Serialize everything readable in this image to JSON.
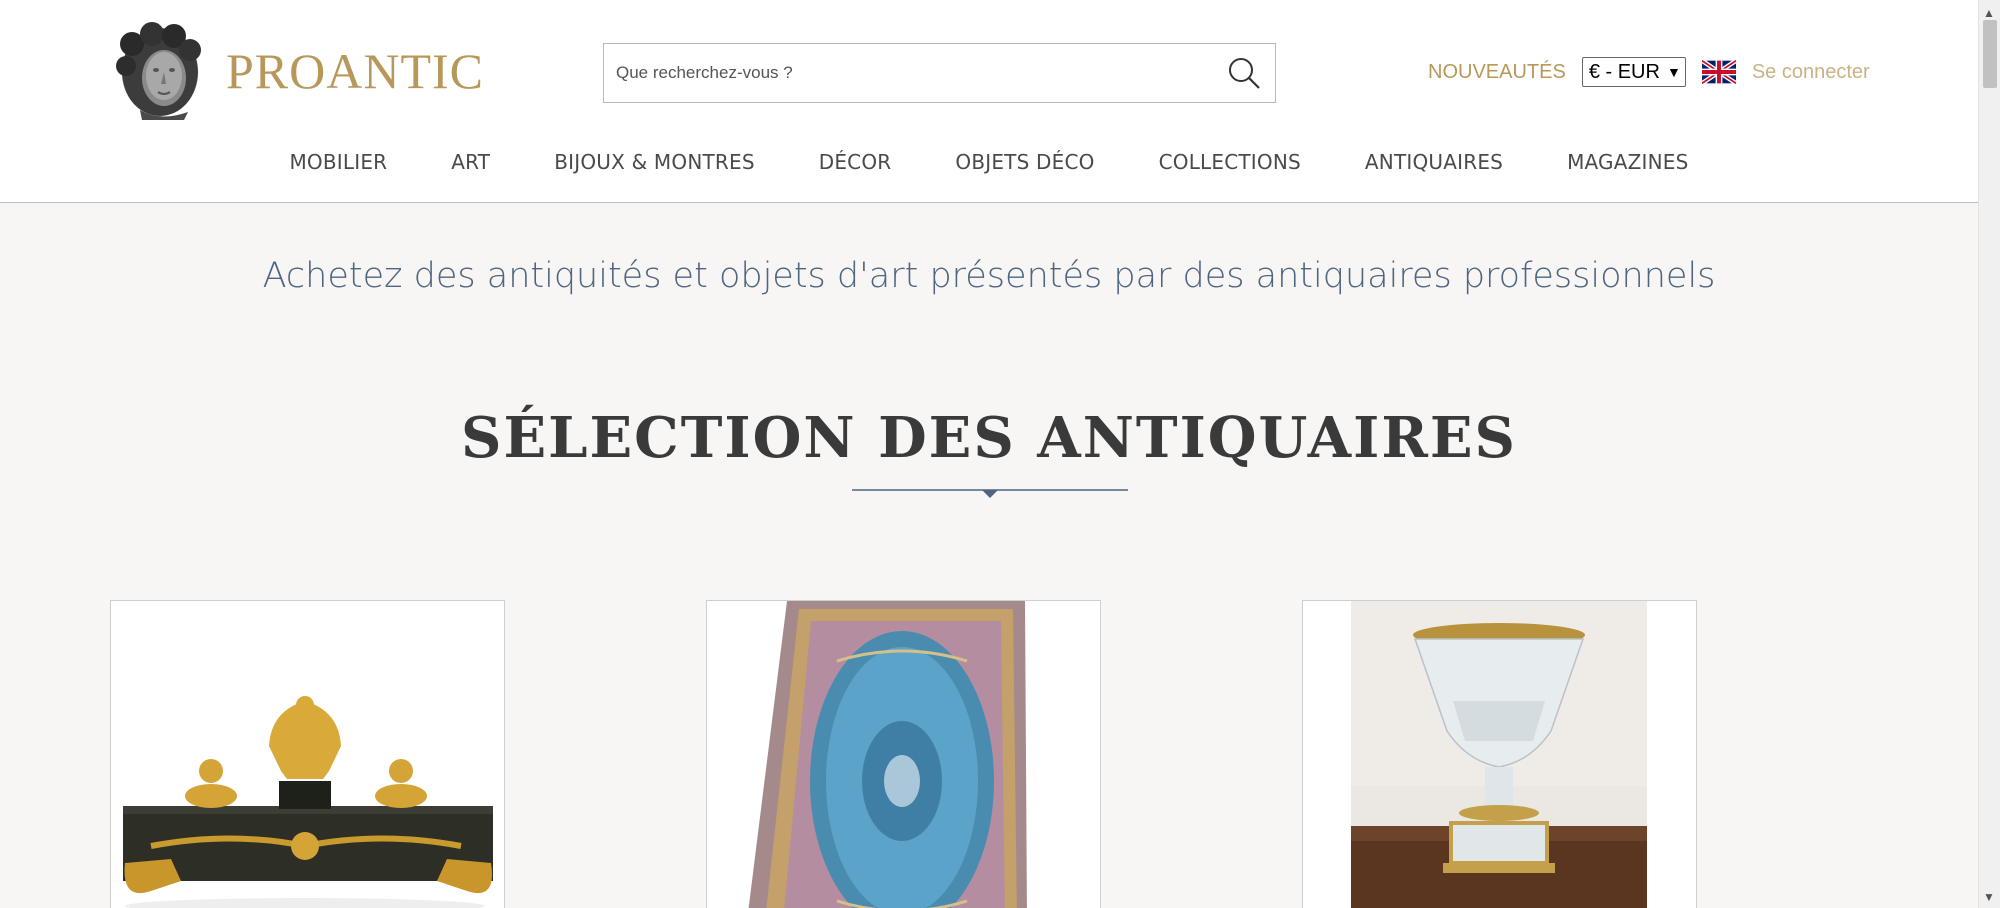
{
  "header": {
    "logo_text": "PROANTIC",
    "search": {
      "placeholder": "Que recherchez-vous ?"
    },
    "nouveautes_label": "NOUVEAUTÉS",
    "currency_value": "€ - EUR",
    "language_icon": "uk-flag-icon",
    "login_label": "Se connecter"
  },
  "nav": {
    "items": [
      {
        "label": "MOBILIER"
      },
      {
        "label": "ART"
      },
      {
        "label": "BIJOUX & MONTRES"
      },
      {
        "label": "DÉCOR"
      },
      {
        "label": "OBJETS DÉCO"
      },
      {
        "label": "COLLECTIONS"
      },
      {
        "label": "ANTIQUAIRES"
      },
      {
        "label": "MAGAZINES"
      }
    ]
  },
  "main": {
    "tagline": "Achetez des antiquités et objets d'art présentés par des antiquaires professionnels",
    "section_title": "SÉLECTION DES ANTIQUAIRES"
  },
  "colors": {
    "brand_gold": "#b8985a",
    "tagline_blue": "#4d6580",
    "background": "#f7f6f4"
  }
}
